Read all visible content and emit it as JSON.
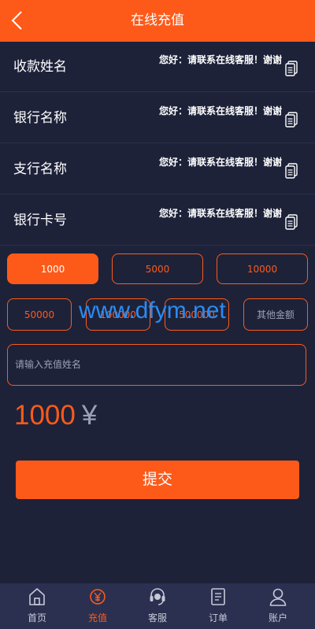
{
  "header": {
    "title": "在线充值"
  },
  "info_rows": [
    {
      "label": "收款姓名",
      "value": "您好：请联系在线客服！谢谢"
    },
    {
      "label": "银行名称",
      "value": "您好：请联系在线客服！谢谢"
    },
    {
      "label": "支行名称",
      "value": "您好：请联系在线客服！谢谢"
    },
    {
      "label": "银行卡号",
      "value": "您好：请联系在线客服！谢谢"
    }
  ],
  "amounts_row1": [
    "1000",
    "5000",
    "10000"
  ],
  "amounts_row2": [
    "50000",
    "100000",
    "500000",
    "其他金额"
  ],
  "selected_amount": "1000",
  "name_input": {
    "placeholder": "请输入充值姓名",
    "value": ""
  },
  "amount_display": {
    "value": "1000",
    "currency": "¥"
  },
  "submit_label": "提交",
  "watermark": "www.dfym.net",
  "tabbar": [
    {
      "label": "首页",
      "icon": "home-icon"
    },
    {
      "label": "充值",
      "icon": "recharge-icon",
      "active": true
    },
    {
      "label": "客服",
      "icon": "customer-service-icon"
    },
    {
      "label": "订单",
      "icon": "order-icon"
    },
    {
      "label": "账户",
      "icon": "user-icon"
    }
  ],
  "colors": {
    "accent": "#fd5a1a",
    "background": "#1d2239",
    "tabbar": "#2b3050"
  }
}
